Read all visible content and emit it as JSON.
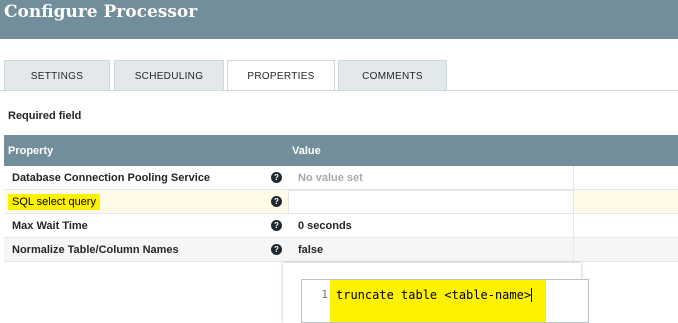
{
  "header": {
    "title": "Configure Processor"
  },
  "tabs": [
    {
      "label": "SETTINGS"
    },
    {
      "label": "SCHEDULING"
    },
    {
      "label": "PROPERTIES"
    },
    {
      "label": "COMMENTS"
    }
  ],
  "active_tab": "PROPERTIES",
  "required_label": "Required field",
  "table": {
    "columns": {
      "property": "Property",
      "value": "Value"
    },
    "rows": [
      {
        "name": "Database Connection Pooling Service",
        "value": "No value set"
      },
      {
        "name": "SQL select query",
        "value": ""
      },
      {
        "name": "Max Wait Time",
        "value": "0 seconds"
      },
      {
        "name": "Normalize Table/Column Names",
        "value": "false"
      }
    ]
  },
  "editor": {
    "line_number": "1",
    "code": "truncate table <table-name>"
  },
  "icons": {
    "help": "help-circle-icon"
  },
  "colors": {
    "header": "#728e9b",
    "highlight": "#fff200"
  }
}
